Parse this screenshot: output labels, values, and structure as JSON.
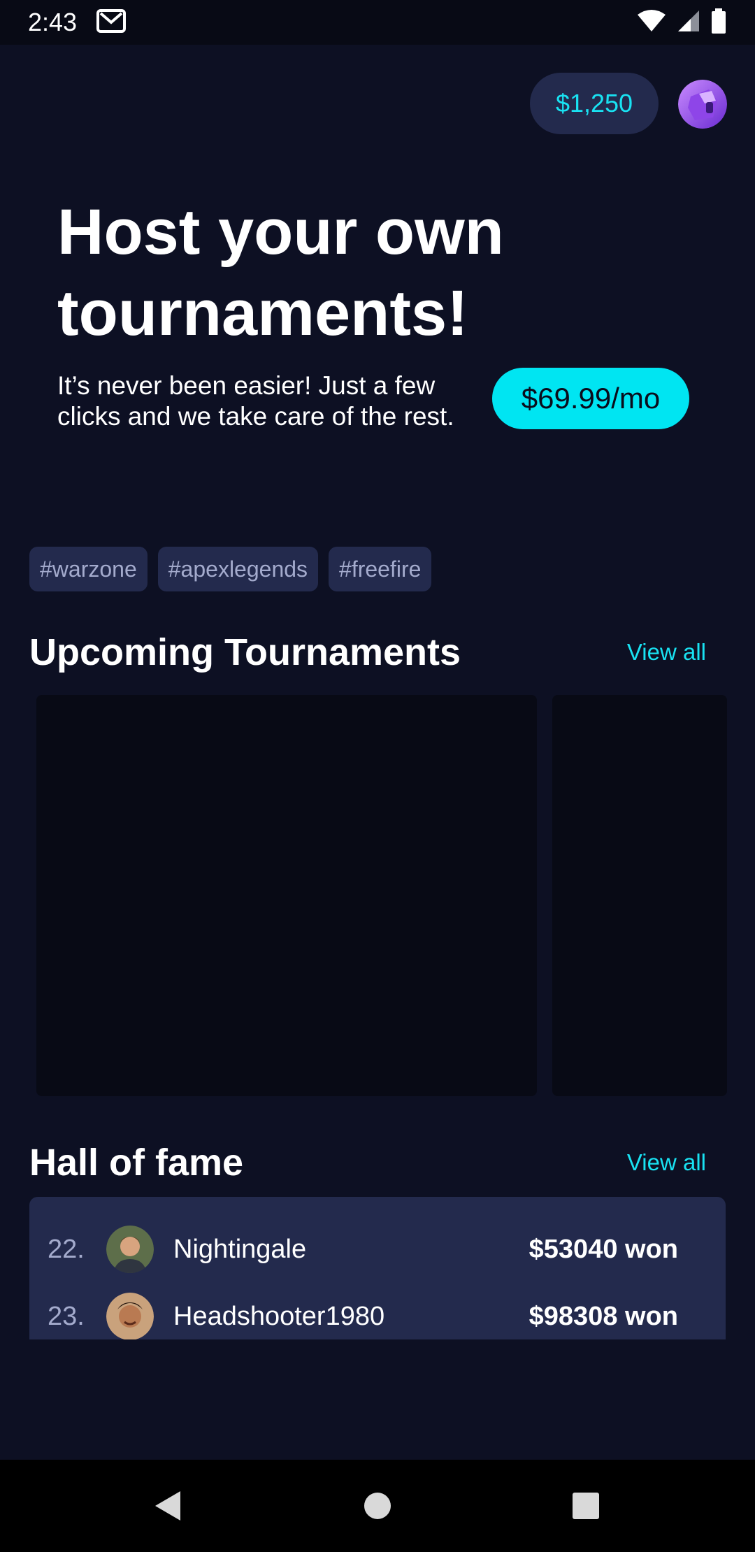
{
  "status_bar": {
    "time": "2:43"
  },
  "header": {
    "balance": "$1,250"
  },
  "hero": {
    "title": "Host your own tournaments!",
    "subtitle": "It’s never been easier! Just a few clicks and we take care of the rest.",
    "price_button": "$69.99/mo"
  },
  "tags": [
    "#warzone",
    "#apexlegends",
    "#freefire"
  ],
  "upcoming": {
    "title": "Upcoming Tournaments",
    "view_all": "View all"
  },
  "hall_of_fame": {
    "title": "Hall of fame",
    "view_all": "View all",
    "entries": [
      {
        "rank": "22.",
        "name": "Nightingale",
        "amount": "$53040 won"
      },
      {
        "rank": "23.",
        "name": "Headshooter1980",
        "amount": "$98308 won"
      }
    ]
  },
  "colors": {
    "background": "#0d1023",
    "accent": "#00e5f2",
    "panel": "#232a4d"
  }
}
